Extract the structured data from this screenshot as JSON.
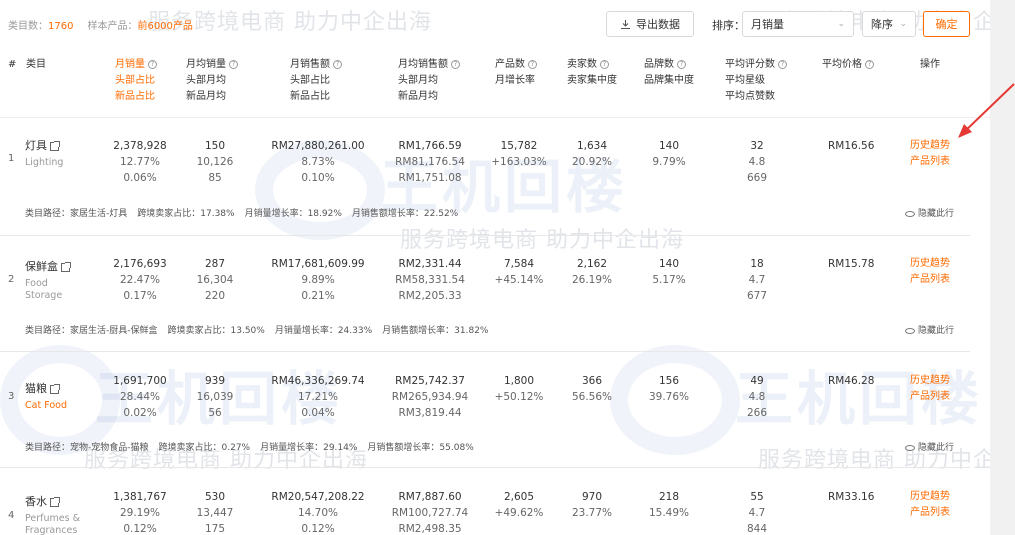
{
  "toolbar": {
    "count_label": "类目数：",
    "count_value": "1760",
    "sample_label": "样本产品：",
    "sample_value": "前6000产品",
    "export_label": "导出数据",
    "sort_label": "排序：",
    "sort_field": "月销量",
    "sort_order": "降序",
    "confirm_label": "确定"
  },
  "header": {
    "index": "#",
    "category": "类目",
    "col1": [
      "月销量",
      "头部占比",
      "新品占比"
    ],
    "col2": [
      "月均销量",
      "头部月均",
      "新品月均"
    ],
    "col3": [
      "月销售额",
      "头部占比",
      "新品占比"
    ],
    "col4": [
      "月均销售额",
      "头部月均",
      "新品月均"
    ],
    "col5": [
      "产品数",
      "月增长率"
    ],
    "col6": [
      "卖家数",
      "卖家集中度"
    ],
    "col7": [
      "品牌数",
      "品牌集中度"
    ],
    "col8": [
      "平均评分数",
      "平均星级",
      "平均点赞数"
    ],
    "col9": "平均价格",
    "col10": "操作"
  },
  "rows": [
    {
      "index": "1",
      "name": "灯具",
      "en": "Lighting",
      "c1": [
        "2,378,928",
        "12.77%",
        "0.06%"
      ],
      "c2": [
        "150",
        "10,126",
        "85"
      ],
      "c3": [
        "RM27,880,261.00",
        "8.73%",
        "0.10%"
      ],
      "c4": [
        "RM1,766.59",
        "RM81,176.54",
        "RM1,751.08"
      ],
      "c5": [
        "15,782",
        "+163.03%"
      ],
      "c6": [
        "1,634",
        "20.92%"
      ],
      "c7": [
        "140",
        "9.79%"
      ],
      "c8": [
        "32",
        "4.8",
        "669"
      ],
      "price": "RM16.56",
      "op1": "历史趋势",
      "op2": "产品列表",
      "path": "类目路径：家居生活-灯具",
      "cross": "跨境卖家占比：17.38%",
      "sales_growth": "月销量增长率：18.92%",
      "revenue_growth": "月销售额增长率：22.52%",
      "hide": "隐藏此行"
    },
    {
      "index": "2",
      "name": "保鲜盒",
      "en": "Food Storage",
      "c1": [
        "2,176,693",
        "22.47%",
        "0.17%"
      ],
      "c2": [
        "287",
        "16,304",
        "220"
      ],
      "c3": [
        "RM17,681,609.99",
        "9.89%",
        "0.21%"
      ],
      "c4": [
        "RM2,331.44",
        "RM58,331.54",
        "RM2,205.33"
      ],
      "c5": [
        "7,584",
        "+45.14%"
      ],
      "c6": [
        "2,162",
        "26.19%"
      ],
      "c7": [
        "140",
        "5.17%"
      ],
      "c8": [
        "18",
        "4.7",
        "677"
      ],
      "price": "RM15.78",
      "op1": "历史趋势",
      "op2": "产品列表",
      "path": "类目路径：家居生活-厨具-保鲜盒",
      "cross": "跨境卖家占比：13.50%",
      "sales_growth": "月销量增长率：24.33%",
      "revenue_growth": "月销售额增长率：31.82%",
      "hide": "隐藏此行"
    },
    {
      "index": "3",
      "name": "猫粮",
      "en": "Cat Food",
      "c1": [
        "1,691,700",
        "28.44%",
        "0.02%"
      ],
      "c2": [
        "939",
        "16,039",
        "56"
      ],
      "c3": [
        "RM46,336,269.74",
        "17.21%",
        "0.04%"
      ],
      "c4": [
        "RM25,742.37",
        "RM265,934.94",
        "RM3,819.44"
      ],
      "c5": [
        "1,800",
        "+50.12%"
      ],
      "c6": [
        "366",
        "56.56%"
      ],
      "c7": [
        "156",
        "39.76%"
      ],
      "c8": [
        "49",
        "4.8",
        "266"
      ],
      "price": "RM46.28",
      "op1": "历史趋势",
      "op2": "产品列表",
      "path": "类目路径：宠物-宠物食品-猫粮",
      "cross": "跨境卖家占比：0.27%",
      "sales_growth": "月销量增长率：29.14%",
      "revenue_growth": "月销售额增长率：55.08%",
      "hide": "隐藏此行"
    },
    {
      "index": "4",
      "name": "香水",
      "en": "Perfumes & Fragrances",
      "c1": [
        "1,381,767",
        "29.19%",
        "0.12%"
      ],
      "c2": [
        "530",
        "13,447",
        "175"
      ],
      "c3": [
        "RM20,547,208.22",
        "14.70%",
        "0.12%"
      ],
      "c4": [
        "RM7,887.60",
        "RM100,727.74",
        "RM2,498.35"
      ],
      "c5": [
        "2,605",
        "+49.62%"
      ],
      "c6": [
        "970",
        "23.77%"
      ],
      "c7": [
        "218",
        "15.49%"
      ],
      "c8": [
        "55",
        "4.7",
        "844"
      ],
      "price": "RM33.16",
      "op1": "历史趋势",
      "op2": "产品列表",
      "path": "",
      "cross": "",
      "sales_growth": "",
      "revenue_growth": "",
      "hide": ""
    }
  ],
  "watermarks": {
    "slogan": "服务跨境电商 助力中企出海",
    "logo": "王机回楼"
  },
  "colors": {
    "accent": "#ff6a00",
    "text": "#333333",
    "muted": "#999999",
    "arrow": "#e53935"
  },
  "icons": {
    "export": "download-icon",
    "external": "external-link-icon",
    "hide": "eye-icon",
    "help": "question-circle-icon"
  }
}
